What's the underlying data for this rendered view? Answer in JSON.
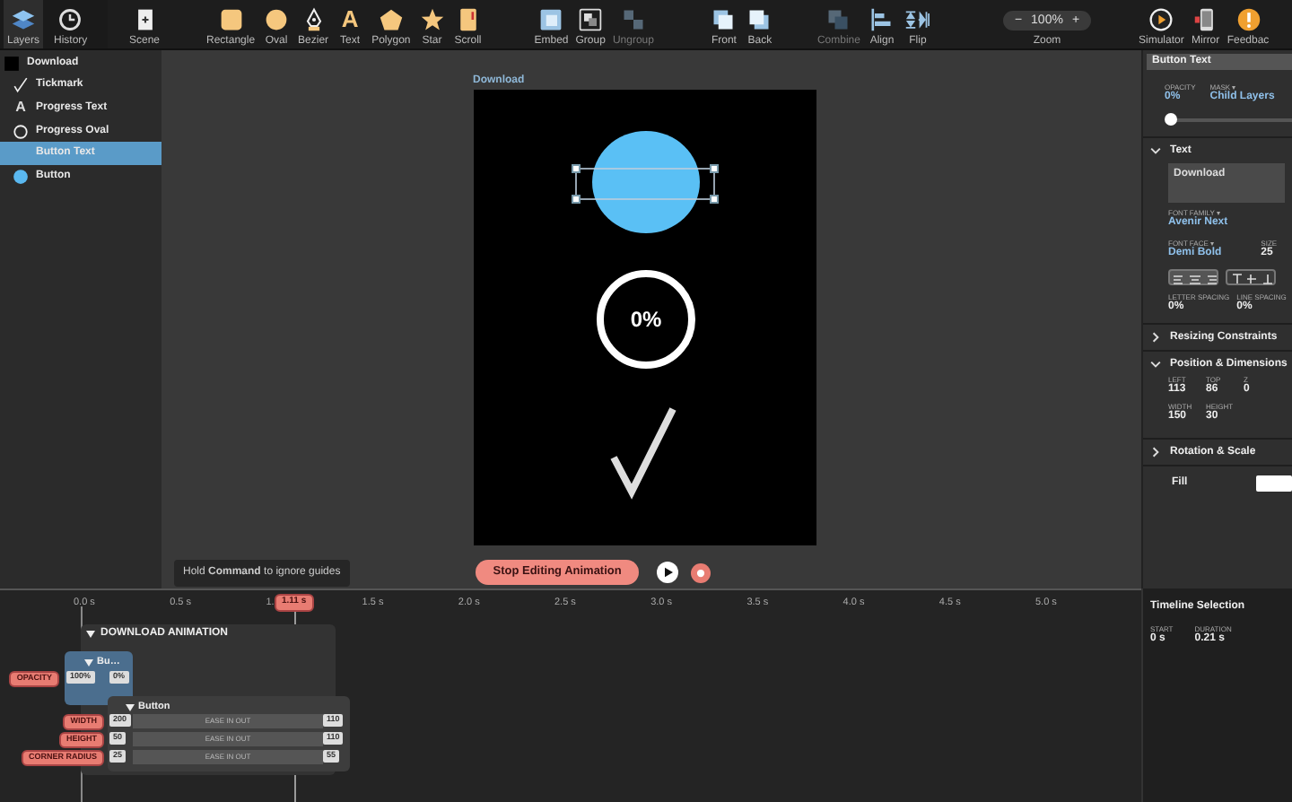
{
  "panel_tabs": [
    {
      "label": "Layers",
      "selected": true
    },
    {
      "label": "History",
      "selected": false
    }
  ],
  "toolbar": [
    {
      "items": [
        {
          "label": "Scene",
          "disabled": false
        }
      ]
    },
    {
      "items": [
        {
          "label": "Rectangle",
          "disabled": false
        },
        {
          "label": "Oval",
          "disabled": false
        },
        {
          "label": "Bezier",
          "disabled": false
        },
        {
          "label": "Text",
          "glyph": "A",
          "disabled": false
        },
        {
          "label": "Polygon",
          "disabled": false
        },
        {
          "label": "Star",
          "disabled": false
        },
        {
          "label": "Scroll",
          "disabled": false
        }
      ]
    },
    {
      "items": [
        {
          "label": "Embed",
          "disabled": false
        },
        {
          "label": "Group",
          "disabled": false
        },
        {
          "label": "Ungroup",
          "disabled": true
        }
      ]
    },
    {
      "items": [
        {
          "label": "Front",
          "disabled": false
        },
        {
          "label": "Back",
          "disabled": false
        }
      ]
    },
    {
      "items": [
        {
          "label": "Combine",
          "disabled": true
        },
        {
          "label": "Align",
          "disabled": false
        },
        {
          "label": "Flip",
          "disabled": false
        }
      ]
    },
    {
      "items": [
        {
          "label": "Zoom",
          "kind": "zoom",
          "minus": "−",
          "value": "100%",
          "plus": "+"
        }
      ]
    },
    {
      "items": [
        {
          "label": "Simulator",
          "disabled": false
        },
        {
          "label": "Mirror",
          "disabled": false
        },
        {
          "label": "Feedbac",
          "disabled": false
        }
      ]
    }
  ],
  "layers": [
    {
      "name": "Download",
      "selected": false,
      "children": [
        {
          "name": "Tickmark",
          "selected": false
        },
        {
          "name": "Progress Text",
          "glyph": "A",
          "selected": false
        },
        {
          "name": "Progress Oval",
          "selected": false
        },
        {
          "name": "Button Text",
          "selected": true
        },
        {
          "name": "Button",
          "selected": false
        }
      ]
    }
  ],
  "canvas": {
    "artboard_title": "Download",
    "button_selected": true,
    "progress_text": "0%",
    "hint": "Hold **Command** to ignore guides",
    "stop_button": "Stop Editing Animation"
  },
  "inspector": {
    "layer_name": "Button Text",
    "opacity": {
      "label": "OPACITY",
      "value": "0%",
      "level": 0
    },
    "mask": {
      "label": "MASK ▾",
      "value": "Child Layers"
    },
    "sections": [
      {
        "title": "Text",
        "expanded": true,
        "kind": "text",
        "content": "Download",
        "font_family": {
          "label": "FONT FAMILY ▾",
          "value": "Avenir Next"
        },
        "font_face": {
          "label": "FONT FACE ▾",
          "value": "Demi Bold"
        },
        "size": {
          "label": "SIZE",
          "value": "25"
        },
        "letter_spacing": {
          "label": "LETTER SPACING",
          "value": "0%"
        },
        "line_spacing": {
          "label": "LINE SPACING",
          "value": "0%"
        }
      },
      {
        "title": "Resizing Constraints",
        "expanded": false,
        "kind": "plain"
      },
      {
        "title": "Position & Dimensions",
        "expanded": true,
        "kind": "fields",
        "fields": [
          [
            {
              "label": "LEFT",
              "value": "113"
            },
            {
              "label": "TOP",
              "value": "86"
            },
            {
              "label": "Z",
              "value": "0"
            }
          ],
          [
            {
              "label": "WIDTH",
              "value": "150"
            },
            {
              "label": "HEIGHT",
              "value": "30"
            }
          ]
        ]
      },
      {
        "title": "Rotation & Scale",
        "expanded": false,
        "kind": "plain"
      },
      {
        "title": "Fill",
        "kind": "fill"
      }
    ]
  },
  "timeline": {
    "ruler": [
      "0.0 s",
      "0.5 s",
      "1.",
      "1.5 s",
      "2.0 s",
      "2.5 s",
      "3.0 s",
      "3.5 s",
      "4.0 s",
      "4.5 s",
      "5.0 s"
    ],
    "playhead": "1.11 s",
    "group": {
      "title": "DOWNLOAD ANIMATION",
      "expanded": true,
      "children": [
        {
          "title": "Bu…",
          "expanded": true,
          "tracks": [
            {
              "property": "OPACITY",
              "from": "100%",
              "to": "0%"
            }
          ]
        },
        {
          "title": "Button",
          "expanded": true,
          "tracks": [
            {
              "property": "WIDTH",
              "from": "200",
              "easing": "EASE IN OUT",
              "to": "110"
            },
            {
              "property": "HEIGHT",
              "from": "50",
              "easing": "EASE IN OUT",
              "to": "110"
            },
            {
              "property": "CORNER RADIUS",
              "from": "25",
              "easing": "EASE IN OUT",
              "to": "55"
            }
          ]
        }
      ]
    }
  },
  "timeline_selection": {
    "title": "Timeline Selection",
    "start": {
      "label": "START",
      "value": "0 s"
    },
    "duration": {
      "label": "DURATION",
      "value": "0.21 s"
    }
  }
}
